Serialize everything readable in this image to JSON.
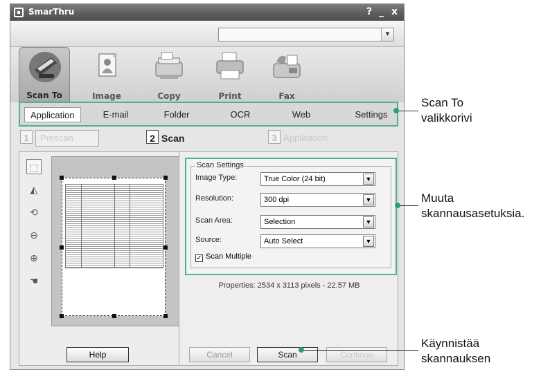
{
  "window": {
    "title": "SmarThru",
    "help": "?",
    "minimize": "_",
    "close": "x"
  },
  "toolbar": {
    "combo_value": "",
    "tools": [
      {
        "label": "Scan To",
        "icon": "scanner-icon"
      },
      {
        "label": "Image",
        "icon": "image-icon"
      },
      {
        "label": "Copy",
        "icon": "copier-icon"
      },
      {
        "label": "Print",
        "icon": "printer-icon"
      },
      {
        "label": "Fax",
        "icon": "fax-icon"
      }
    ]
  },
  "menu": {
    "items": [
      "Application",
      "E-mail",
      "Folder",
      "OCR",
      "Web",
      "Settings"
    ],
    "active": "Application"
  },
  "steps": {
    "s1_num": "1",
    "s1_label": "Prescan",
    "s2_num": "2",
    "s2_label": "Scan",
    "s3_num": "3",
    "s3_label": "Application"
  },
  "settings": {
    "legend": "Scan Settings",
    "image_type_label": "Image Type:",
    "image_type_value": "True Color (24 bit)",
    "resolution_label": "Resolution:",
    "resolution_value": "300 dpi",
    "scan_area_label": "Scan Area:",
    "scan_area_value": "Selection",
    "source_label": "Source:",
    "source_value": "Auto Select",
    "scan_multiple_label": "Scan Multiple",
    "scan_multiple_checked": true
  },
  "properties": "Properties: 2534 x 3113 pixels - 22.57 MB",
  "buttons": {
    "help": "Help",
    "cancel": "Cancel",
    "scan": "Scan",
    "continue": "Continue"
  },
  "callouts": {
    "menu_1": "Scan To",
    "menu_2": "valikkorivi",
    "settings_1": "Muuta",
    "settings_2": "skannausasetuksia.",
    "scan_1": "Käynnistää",
    "scan_2": "skannauksen"
  },
  "colors": {
    "accent": "#4caf96"
  }
}
